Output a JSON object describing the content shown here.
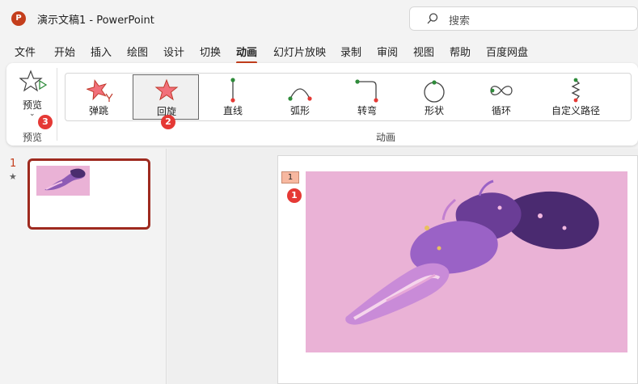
{
  "app": {
    "logo_letter": "P",
    "title": "演示文稿1  -  PowerPoint"
  },
  "search": {
    "placeholder": "搜索"
  },
  "tabs": [
    "文件",
    "开始",
    "插入",
    "绘图",
    "设计",
    "切换",
    "动画",
    "幻灯片放映",
    "录制",
    "审阅",
    "视图",
    "帮助",
    "百度网盘"
  ],
  "active_tab": "动画",
  "ribbon": {
    "preview_button": "预览",
    "preview_group": "预览",
    "animation_group": "动画",
    "animations": [
      "弹跳",
      "回旋",
      "直线",
      "弧形",
      "转弯",
      "形状",
      "循环",
      "自定义路径"
    ],
    "selected_animation": "回旋"
  },
  "badges": [
    "1",
    "2",
    "3"
  ],
  "thumbnails": {
    "slide_number": "1",
    "star": "★"
  },
  "slide": {
    "anim_tag": "1"
  },
  "colors": {
    "accent": "#c43e1c",
    "badge": "#e53935",
    "thumb_border": "#9e2a1f",
    "image_bg": "#eab2d6"
  }
}
